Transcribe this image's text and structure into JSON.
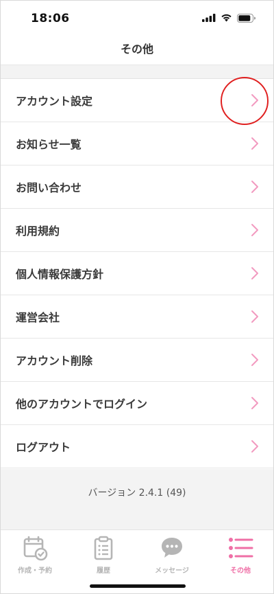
{
  "status": {
    "time": "18:06"
  },
  "nav": {
    "title": "その他"
  },
  "menu": [
    {
      "label": "アカウント設定"
    },
    {
      "label": "お知らせ一覧"
    },
    {
      "label": "お問い合わせ"
    },
    {
      "label": "利用規約"
    },
    {
      "label": "個人情報保護方針"
    },
    {
      "label": "運営会社"
    },
    {
      "label": "アカウント削除"
    },
    {
      "label": "他のアカウントでログイン"
    },
    {
      "label": "ログアウト"
    }
  ],
  "version": "バージョン  2.4.1 (49)",
  "tabs": [
    {
      "label": "作成・予約",
      "icon": "calendar-check-icon",
      "active": false
    },
    {
      "label": "履歴",
      "icon": "clipboard-list-icon",
      "active": false
    },
    {
      "label": "メッセージ",
      "icon": "chat-bubble-icon",
      "active": false
    },
    {
      "label": "その他",
      "icon": "menu-list-icon",
      "active": true
    }
  ],
  "colors": {
    "accent": "#ef6fa6",
    "chevron": "#f29ac0",
    "highlight": "#e02020",
    "inactive_tab": "#b5b5b5"
  }
}
